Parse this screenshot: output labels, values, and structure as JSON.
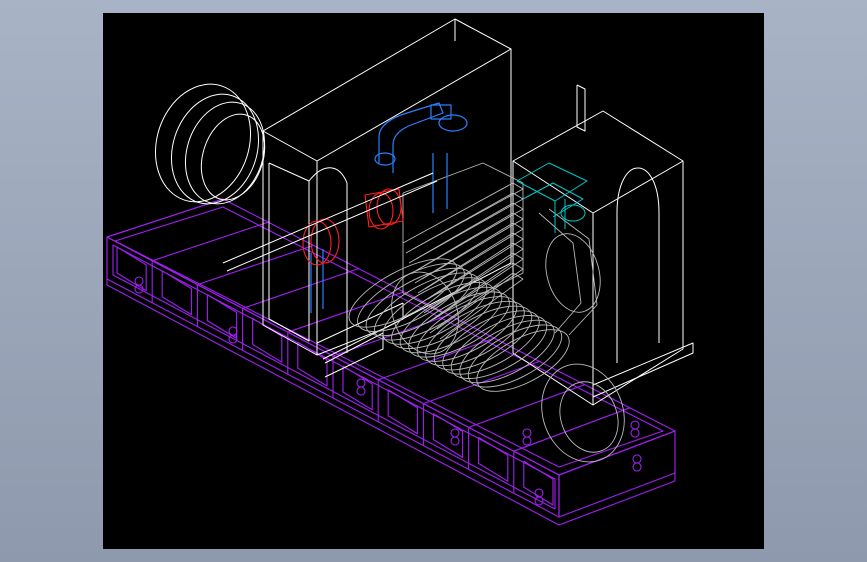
{
  "viewport": {
    "background": "#000000",
    "frame_gradient": [
      "#a9b3c6",
      "#8f99ad"
    ]
  },
  "drawing": {
    "subject": "generator-set-wireframe",
    "layer_colors": {
      "base_frame": "#a020f0",
      "enclosure": "#ffffff",
      "engine": "#b8b8b8",
      "piping": "#2a7fff",
      "coupling": "#ff2020",
      "radiator_parts": "#00c8c8"
    },
    "components": [
      "base-frame",
      "alternator-housing",
      "control-cabinet",
      "fan-ring",
      "engine-block",
      "exhaust-pipe",
      "coupling",
      "turbo-assembly"
    ]
  }
}
